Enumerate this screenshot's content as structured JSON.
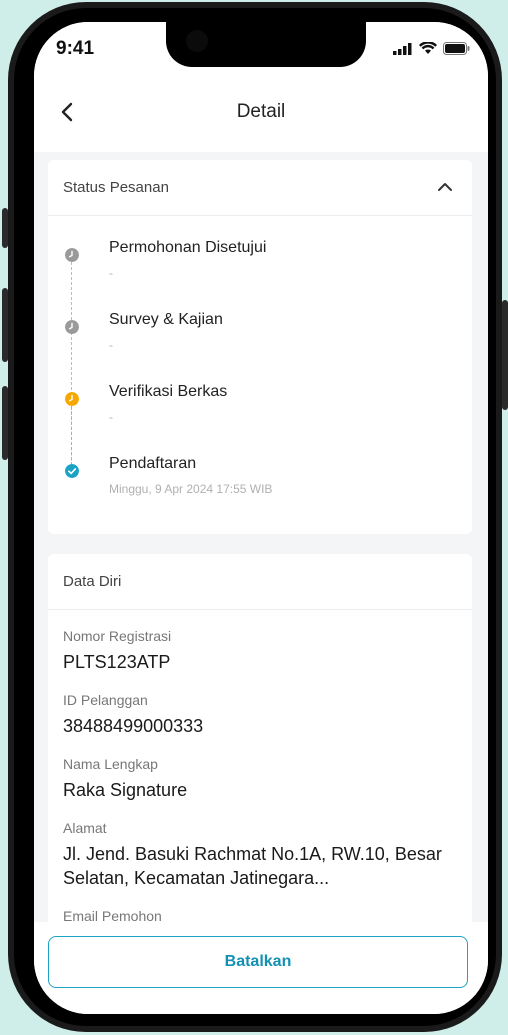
{
  "status_bar": {
    "time": "9:41"
  },
  "header": {
    "title": "Detail"
  },
  "status_card": {
    "title": "Status Pesanan",
    "steps": [
      {
        "label": "Permohonan Disetujui",
        "sub": "-",
        "state": "pending"
      },
      {
        "label": "Survey & Kajian",
        "sub": "-",
        "state": "pending"
      },
      {
        "label": "Verifikasi Berkas",
        "sub": "-",
        "state": "current"
      },
      {
        "label": "Pendaftaran",
        "sub": "Minggu, 9 Apr 2024 17:55 WIB",
        "state": "done"
      }
    ]
  },
  "data_card": {
    "title": "Data Diri",
    "fields": [
      {
        "label": "Nomor Registrasi",
        "value": "PLTS123ATP"
      },
      {
        "label": "ID Pelanggan",
        "value": "38488499000333"
      },
      {
        "label": "Nama Lengkap",
        "value": "Raka Signature"
      },
      {
        "label": "Alamat",
        "value": "Jl. Jend. Basuki Rachmat No.1A, RW.10, Besar Selatan, Kecamatan Jatinegara..."
      },
      {
        "label": "Email Pemohon",
        "value": ""
      }
    ]
  },
  "bottom": {
    "cancel_label": "Batalkan"
  },
  "colors": {
    "pending": "#9a9a9a",
    "current": "#f5a800",
    "done": "#1aa3c4",
    "accent": "#1391b3"
  }
}
